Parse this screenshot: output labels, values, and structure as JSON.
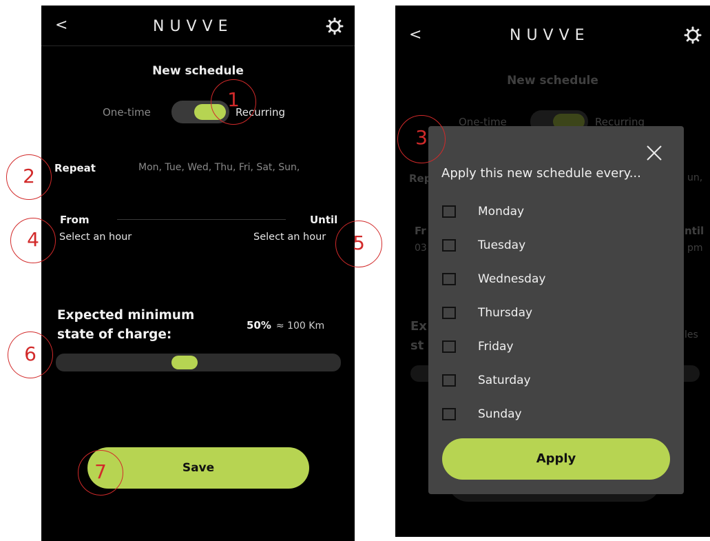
{
  "left": {
    "header": {
      "back": "<",
      "logo": "NUVVE",
      "settings_icon": "gear-icon"
    },
    "title": "New schedule",
    "toggle": {
      "left_label": "One-time",
      "right_label": "Recurring",
      "selected": "Recurring"
    },
    "repeat": {
      "label": "Repeat",
      "value": "Mon, Tue, Wed, Thu, Fri, Sat, Sun,"
    },
    "from": {
      "label": "From",
      "value": "Select an hour"
    },
    "until": {
      "label": "Until",
      "value": "Select an hour"
    },
    "charge": {
      "label_line1": "Expected minimum",
      "label_line2": "state of charge:",
      "percent": "50%",
      "approx": "≈ 100 Km",
      "level_percent": 50
    },
    "save_label": "Save"
  },
  "annotations": [
    "1",
    "2",
    "3",
    "4",
    "5",
    "6",
    "7"
  ],
  "right": {
    "header": {
      "back": "<",
      "logo": "NUVVE",
      "settings_icon": "gear-icon"
    },
    "bg": {
      "title": "New schedule",
      "one_time": "One-time",
      "recurring": "Recurring",
      "repeat_partial": "Rep",
      "repeat_value_partial": "un,",
      "from_partial": "Fr",
      "from_value_partial": "03",
      "until_partial": "ntil",
      "until_value_partial": "pm",
      "charge_partial1": "Ex",
      "charge_partial2": "st",
      "charge_value_partial": "les"
    },
    "modal": {
      "close_icon": "close-icon",
      "title": "Apply this new schedule every...",
      "days": [
        "Monday",
        "Tuesday",
        "Wednesday",
        "Thursday",
        "Friday",
        "Saturday",
        "Sunday"
      ],
      "apply_label": "Apply"
    }
  }
}
